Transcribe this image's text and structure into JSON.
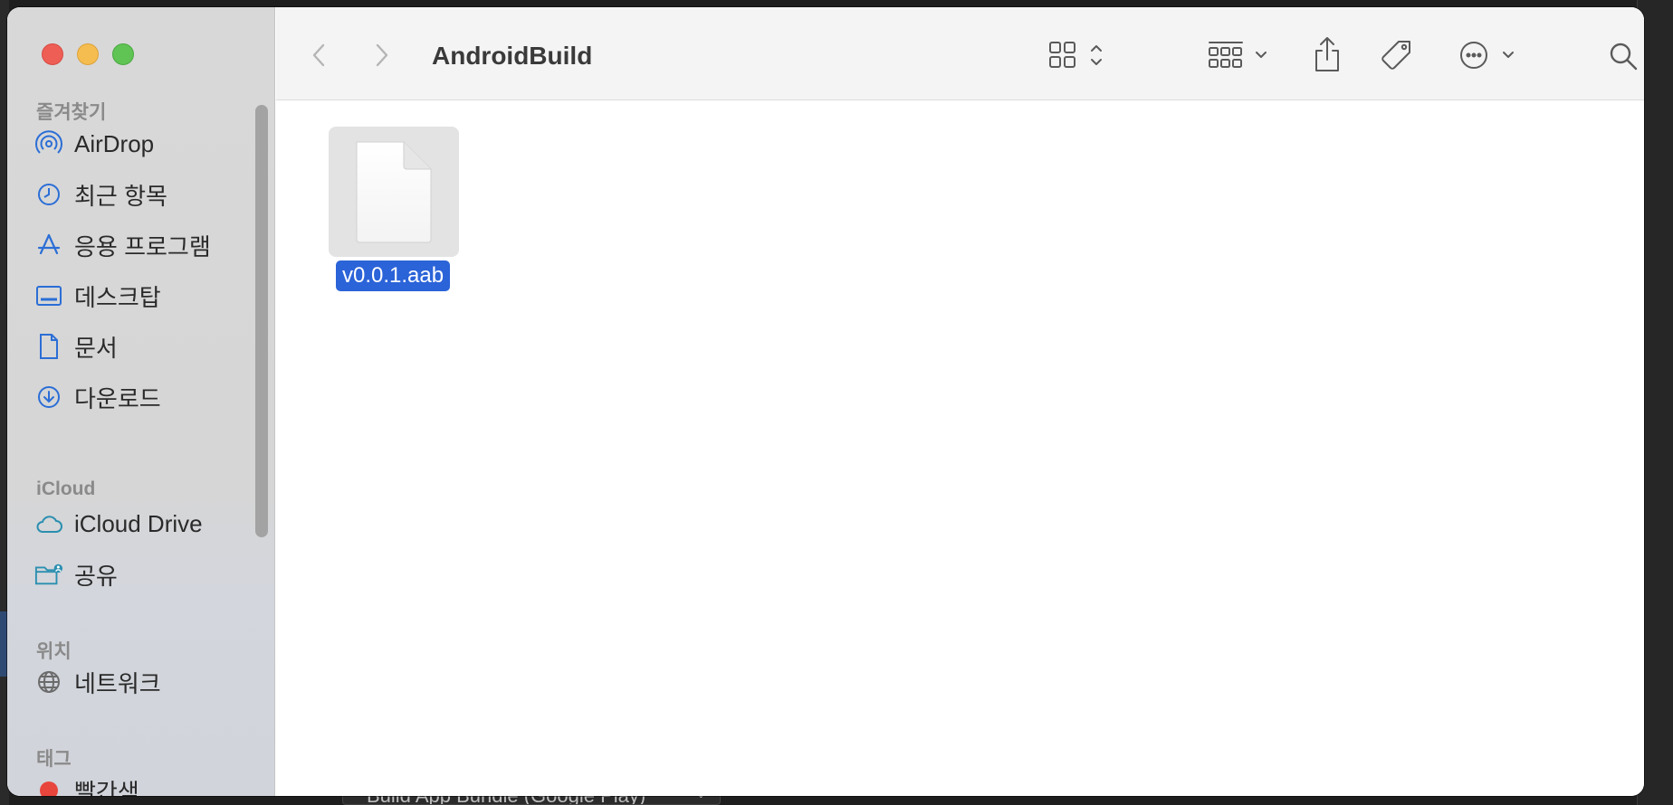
{
  "window": {
    "title": "AndroidBuild"
  },
  "sidebar": {
    "sections": {
      "favorites": "즐겨찾기",
      "icloud": "iCloud",
      "locations": "위치",
      "tags": "태그"
    },
    "favorites": [
      {
        "label": "AirDrop",
        "icon": "airdrop-icon"
      },
      {
        "label": "최근 항목",
        "icon": "clock-icon"
      },
      {
        "label": "응용 프로그램",
        "icon": "apps-icon"
      },
      {
        "label": "데스크탑",
        "icon": "desktop-icon"
      },
      {
        "label": "문서",
        "icon": "document-icon"
      },
      {
        "label": "다운로드",
        "icon": "download-icon"
      }
    ],
    "icloud": [
      {
        "label": "iCloud Drive",
        "icon": "cloud-icon"
      },
      {
        "label": "공유",
        "icon": "shared-folder-icon"
      }
    ],
    "locations": [
      {
        "label": "네트워크",
        "icon": "globe-icon"
      }
    ],
    "tags": [
      {
        "label": "빨간색",
        "color": "#e8453c"
      }
    ]
  },
  "files": [
    {
      "name": "v0.0.1.aab",
      "selected": true
    }
  ],
  "background": {
    "bottom_select": "Build App Bundle (Google Play)"
  },
  "colors": {
    "selection": "#2b63d8",
    "accent_icon": "#2b6ed6"
  }
}
